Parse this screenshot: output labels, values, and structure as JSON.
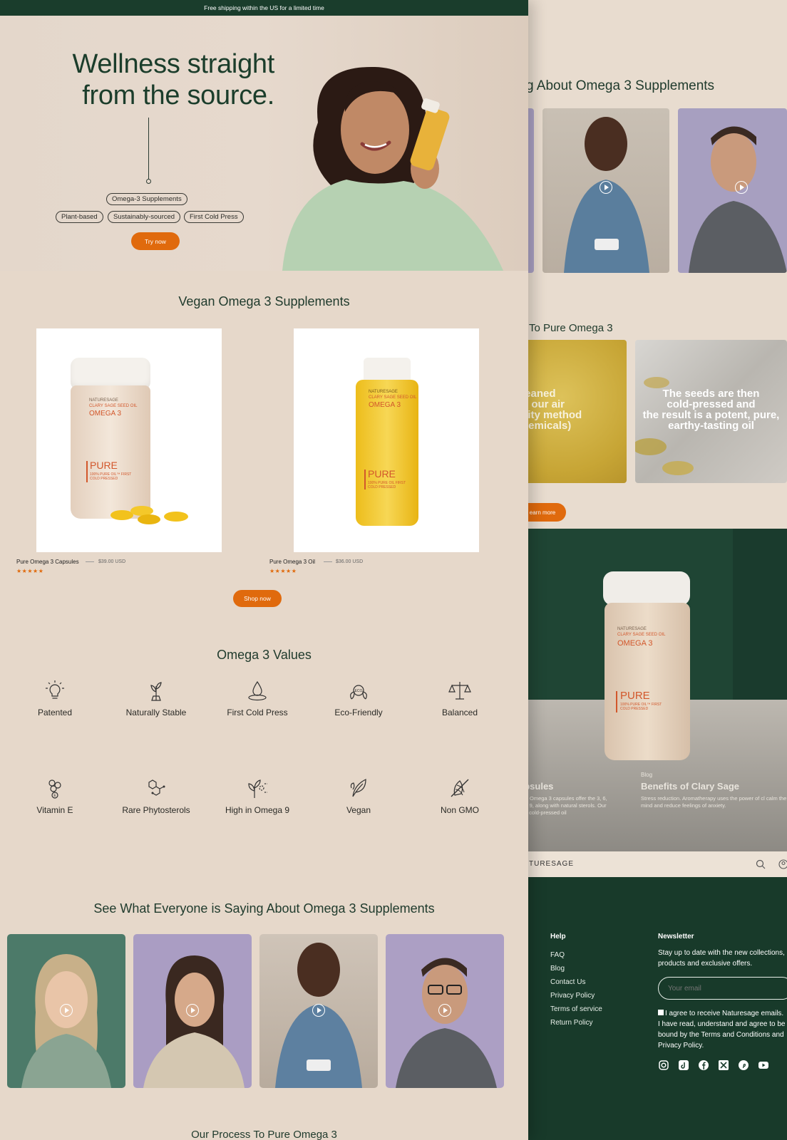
{
  "banner": {
    "text": "Free shipping within the US for a limited time"
  },
  "hero": {
    "headline": "Wellness straight from the source.",
    "tag_main": "Omega-3 Supplements",
    "tags": [
      "Plant-based",
      "Sustainably-sourced",
      "First Cold Press"
    ],
    "cta": "Try now"
  },
  "products": {
    "title": "Vegan Omega 3 Supplements",
    "items": [
      {
        "name": "Pure Omega 3 Capsules",
        "price": "$39.00 USD",
        "rating": "★★★★★",
        "label_brand": "NATURESAGE",
        "label_sub": "CLARY SAGE SEED OIL",
        "label_title": "OMEGA 3",
        "label_pure": "PURE",
        "label_detail": "100% PURE OIL™ FIRST COLD PRESSED"
      },
      {
        "name": "Pure Omega 3 Oil",
        "price": "$36.00 USD",
        "rating": "★★★★★",
        "label_brand": "NATURESAGE",
        "label_sub": "CLARY SAGE SEED OIL",
        "label_title": "OMEGA 3",
        "label_pure": "PURE",
        "label_detail": "100% PURE OIL FIRST COLD PRESSED"
      }
    ],
    "cta": "Shop now"
  },
  "values": {
    "title": "Omega 3 Values",
    "items": [
      {
        "label": "Patented",
        "icon": "lightbulb-icon"
      },
      {
        "label": "Naturally Stable",
        "icon": "plant-icon"
      },
      {
        "label": "First Cold Press",
        "icon": "oil-drop-icon"
      },
      {
        "label": "Eco-Friendly",
        "icon": "eco-leaves-icon"
      },
      {
        "label": "Balanced",
        "icon": "scale-icon"
      },
      {
        "label": "Vitamin E",
        "icon": "vitamin-capsule-icon"
      },
      {
        "label": "Rare Phytosterols",
        "icon": "molecule-icon"
      },
      {
        "label": "High in Omega 9",
        "icon": "sprout-icon"
      },
      {
        "label": "Vegan",
        "icon": "leaf-icon"
      },
      {
        "label": "Non GMO",
        "icon": "no-gmo-icon"
      }
    ]
  },
  "testimonials": {
    "title": "See What Everyone is Saying About Omega 3 Supplements"
  },
  "process": {
    "title": "Our Process To Pure Omega 3"
  },
  "background_page": {
    "testimonials_heading": "g About Omega 3 Supplements",
    "process_heading": "To Pure Omega 3",
    "process_card_left": "leaned\ng our air\nvity method\nhemicals)",
    "process_card_right": "The seeds are then\ncold-pressed and\nthe result is a potent, pure,\nearthy-tasting oil",
    "learn_more": "earn more",
    "bottle_brand": "NATURESAGE",
    "bottle_sub": "CLARY SAGE SEED OIL",
    "bottle_title": "OMEGA 3",
    "bottle_pure": "PURE",
    "bottle_detail": "100% PURE OIL™ FIRST COLD PRESSED",
    "blog_left_title": "apsules",
    "blog_left_text": "l Oil Omega 3 capsules offer the 3, 6, and 9, along with natural sterols. Our first cold-pressed oil",
    "blog_tag": "Blog",
    "blog_right_title": "Benefits of Clary Sage",
    "blog_right_text": "Stress reduction. Aromatherapy uses the power of cl calm the mind and reduce feelings of anxiety.",
    "nav_logo": "TURESAGE",
    "footer": {
      "help_title": "Help",
      "help_links": [
        "FAQ",
        "Blog",
        "Contact Us",
        "Privacy Policy",
        "Terms of service",
        "Return Policy"
      ],
      "newsletter_title": "Newsletter",
      "newsletter_text": "Stay up to date with the new collections, products and exclusive offers.",
      "email_placeholder": "Your email",
      "consent_text": "I agree to receive Naturesage emails. I have read, understand and agree to be bound by the Terms and Conditions and Privacy Policy."
    }
  },
  "colors": {
    "accent": "#e06a0d",
    "brand_green": "#1a3d2c",
    "background": "#e6d8ca"
  }
}
